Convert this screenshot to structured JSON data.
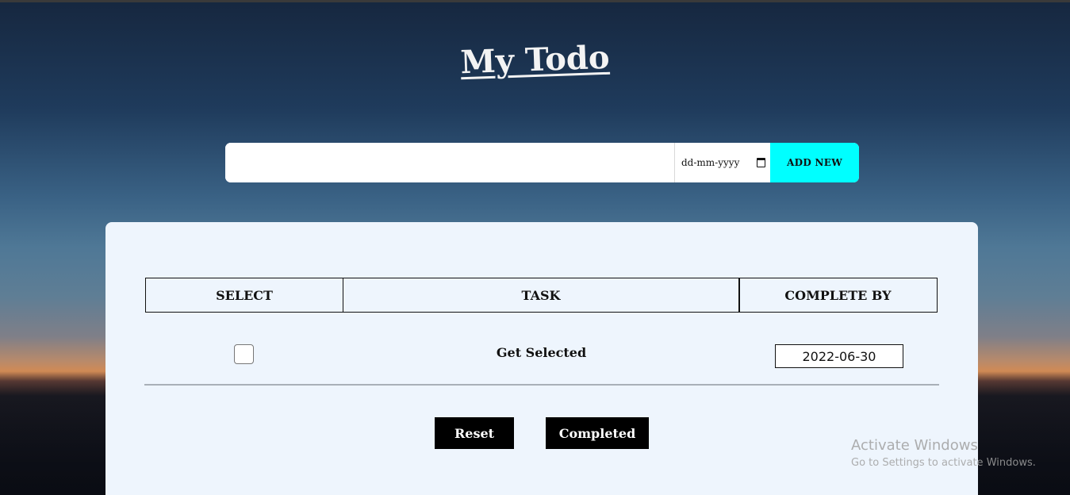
{
  "app": {
    "title": "My Todo"
  },
  "add_bar": {
    "task_value": "",
    "date_placeholder": "dd-mm-yyyy",
    "add_button_label": "ADD NEW",
    "add_button_color": "#00ffff"
  },
  "table": {
    "headers": [
      "SELECT",
      "TASK",
      "COMPLETE BY"
    ],
    "rows": [
      {
        "selected": false,
        "task": "Get Selected",
        "complete_by": "2022-06-30"
      }
    ]
  },
  "actions": {
    "reset_label": "Reset",
    "completed_label": "Completed"
  },
  "watermark": {
    "line1": "Activate Windows",
    "line2": "Go to Settings to activate Windows."
  },
  "colors": {
    "card_bg": "#eef5fd",
    "button_bg": "#000000"
  }
}
